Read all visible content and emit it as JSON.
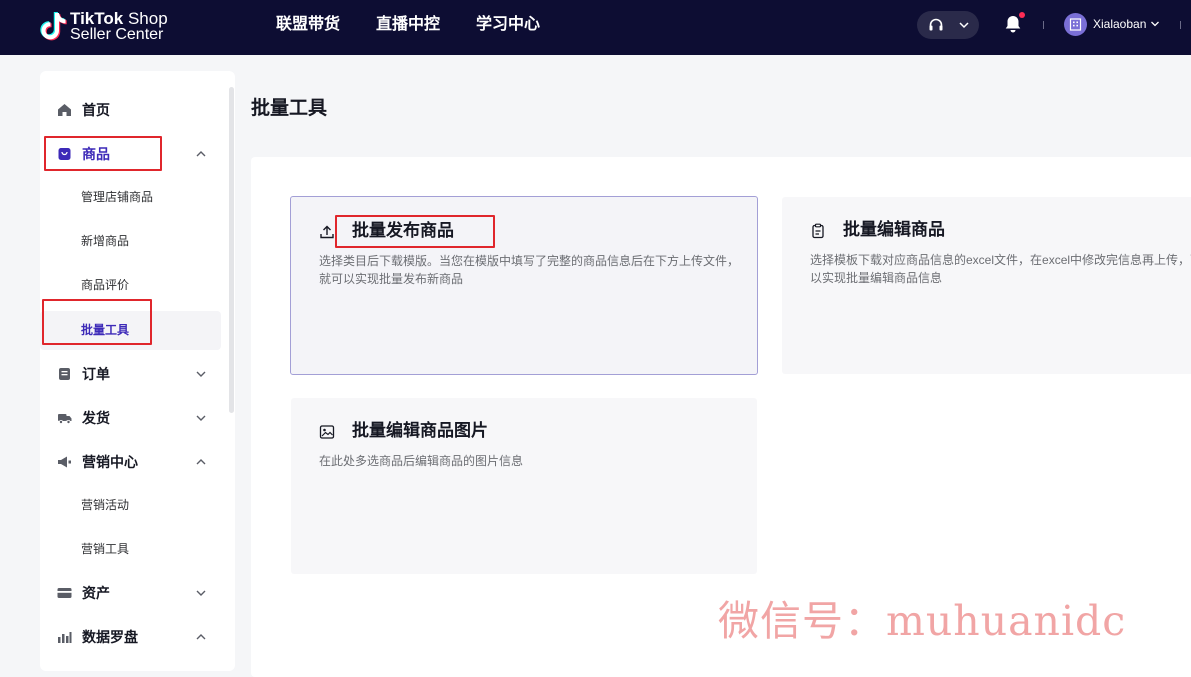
{
  "header": {
    "logo_brand": "TikTok",
    "logo_brand_suffix": "Shop",
    "logo_subtitle": "Seller Center",
    "nav": [
      {
        "label": "联盟带货"
      },
      {
        "label": "直播中控"
      },
      {
        "label": "学习中心"
      }
    ],
    "user_name": "Xialaoban"
  },
  "sidebar": {
    "items": [
      {
        "label": "首页",
        "icon": "home-icon"
      },
      {
        "label": "商品",
        "icon": "shopping-bag-icon",
        "expanded": true,
        "children": [
          {
            "label": "管理店铺商品"
          },
          {
            "label": "新增商品"
          },
          {
            "label": "商品评价"
          },
          {
            "label": "批量工具",
            "active": true
          }
        ]
      },
      {
        "label": "订单",
        "icon": "order-icon",
        "expanded": false
      },
      {
        "label": "发货",
        "icon": "truck-icon",
        "expanded": false
      },
      {
        "label": "营销中心",
        "icon": "megaphone-icon",
        "expanded": true,
        "children": [
          {
            "label": "营销活动"
          },
          {
            "label": "营销工具"
          }
        ]
      },
      {
        "label": "资产",
        "icon": "card-icon",
        "expanded": false
      },
      {
        "label": "数据罗盘",
        "icon": "chart-icon",
        "expanded": true
      }
    ]
  },
  "main": {
    "title": "批量工具",
    "cards": [
      {
        "title": "批量发布商品",
        "icon": "upload-icon",
        "desc": "选择类目后下载模版。当您在模版中填写了完整的商品信息后在下方上传文件，就可以实现批量发布新商品"
      },
      {
        "title": "批量编辑商品",
        "icon": "clipboard-icon",
        "desc": "选择模板下载对应商品信息的excel文件，在excel中修改完信息再上传，可以实现批量编辑商品信息"
      },
      {
        "title": "批量编辑商品图片",
        "icon": "image-icon",
        "desc": "在此处多选商品后编辑商品的图片信息"
      }
    ]
  },
  "watermark": "微信号：muhuanidc",
  "colors": {
    "topbar_bg": "#0d0d33",
    "active_purple": "#3d2ab8",
    "annotation_red": "#e0262c"
  }
}
